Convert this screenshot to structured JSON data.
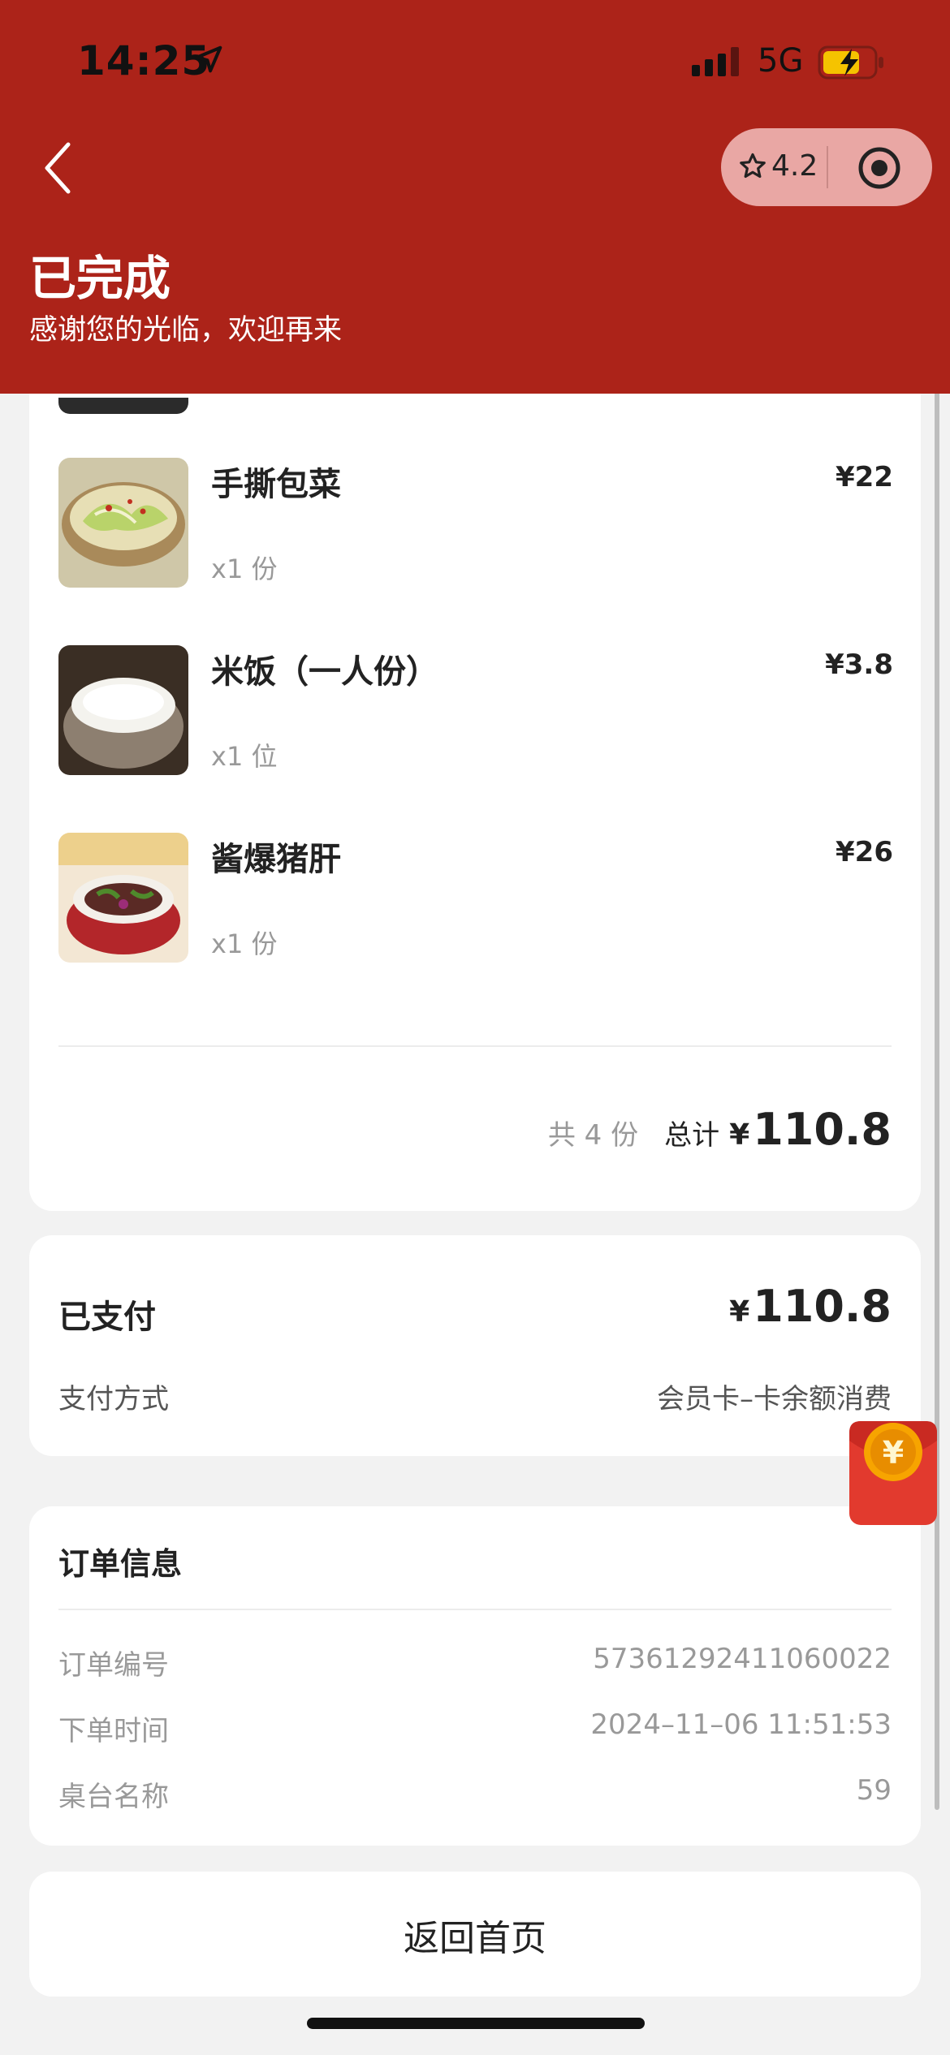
{
  "status_bar": {
    "time": "14:25",
    "network": "5G"
  },
  "header": {
    "rating": "4.2",
    "title": "已完成",
    "subtitle": "感谢您的光临，欢迎再来"
  },
  "items": [
    {
      "name": "手撕包菜",
      "price": "¥22",
      "qty": "x1 份",
      "image": "cabbage-dish"
    },
    {
      "name": "米饭（一人份）",
      "price": "¥3.8",
      "qty": "x1 位",
      "image": "rice-bowl"
    },
    {
      "name": "酱爆猪肝",
      "price": "¥26",
      "qty": "x1 份",
      "image": "pork-liver-dish"
    }
  ],
  "summary": {
    "count": "共 4 份",
    "total_label": "总计",
    "currency": "¥",
    "total": "110.8"
  },
  "payment": {
    "status": "已支付",
    "currency": "¥",
    "amount": "110.8",
    "method_label": "支付方式",
    "method_value": "会员卡–卡余额消费"
  },
  "order_info": {
    "title": "订单信息",
    "rows": [
      {
        "key": "订单编号",
        "value": "57361292411060022"
      },
      {
        "key": "下单时间",
        "value": "2024–11–06 11:51:53"
      },
      {
        "key": "桌台名称",
        "value": "59"
      }
    ]
  },
  "actions": {
    "home_label": "返回首页"
  },
  "icons": {
    "back": "chevron-left-icon",
    "star": "star-icon",
    "target": "target-icon",
    "red_packet": "red-envelope-icon"
  },
  "colors": {
    "header_bg": "#ac2319",
    "capsule_bg": "#e9a7a4",
    "envelope": "#e23a2e"
  }
}
